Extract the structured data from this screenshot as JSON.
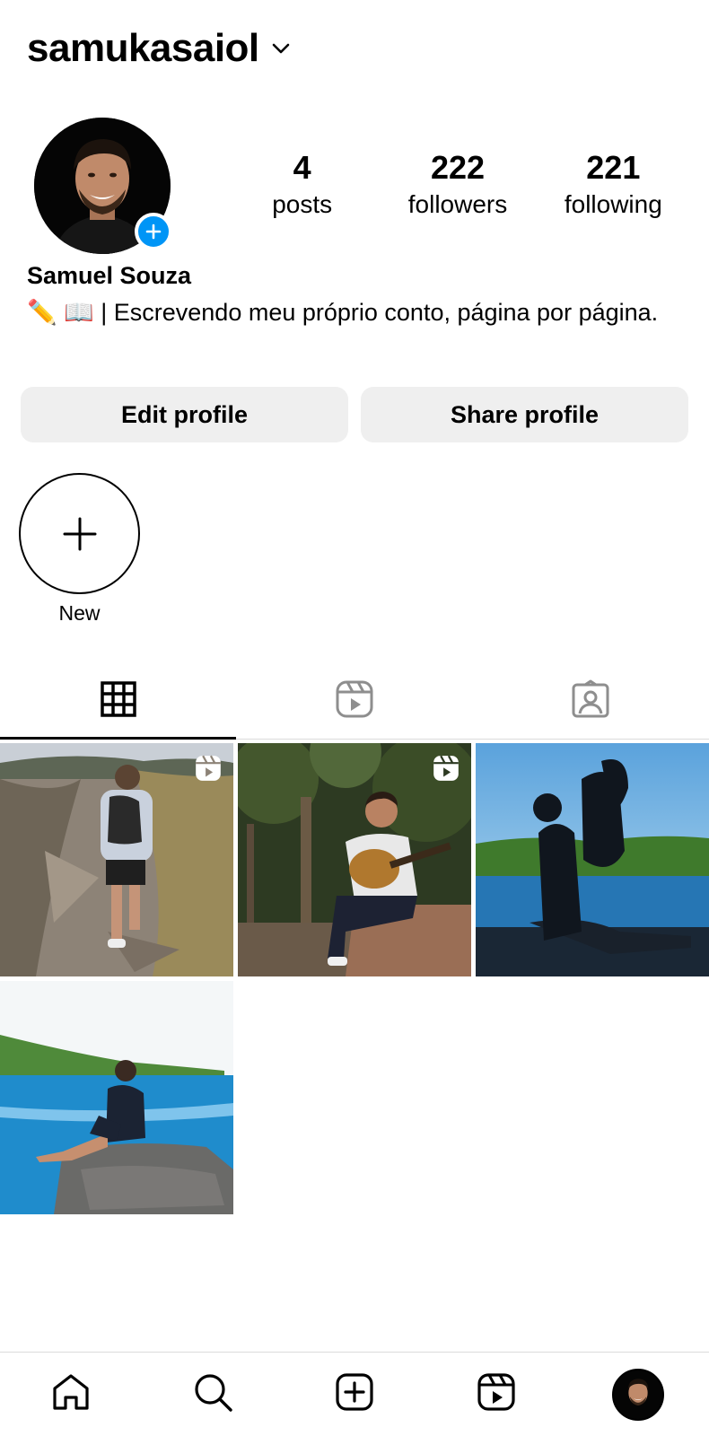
{
  "header": {
    "username": "samukasaiol"
  },
  "profile": {
    "full_name": "Samuel Souza",
    "bio": "✏️ 📖 | Escrevendo meu próprio conto, página por página."
  },
  "stats": [
    {
      "value": "4",
      "label": "posts"
    },
    {
      "value": "222",
      "label": "followers"
    },
    {
      "value": "221",
      "label": "following"
    }
  ],
  "buttons": {
    "edit": "Edit profile",
    "share": "Share profile"
  },
  "highlights": {
    "new_label": "New"
  },
  "tabs": [
    {
      "icon": "grid-icon",
      "active": true
    },
    {
      "icon": "reels-icon",
      "active": false
    },
    {
      "icon": "tagged-icon",
      "active": false
    }
  ],
  "posts": [
    {
      "scene": "hiker on rocky trail",
      "is_reel": true
    },
    {
      "scene": "man playing guitar in forest",
      "is_reel": true
    },
    {
      "scene": "couple embracing at beach",
      "is_reel": false
    },
    {
      "scene": "man sitting on rock by sea",
      "is_reel": false
    }
  ],
  "bottom_nav": [
    "home-icon",
    "search-icon",
    "create-icon",
    "reels-icon",
    "profile-avatar"
  ],
  "colors": {
    "accent": "#0095f6",
    "button_bg": "#efefef",
    "divider": "#dbdbdb"
  }
}
